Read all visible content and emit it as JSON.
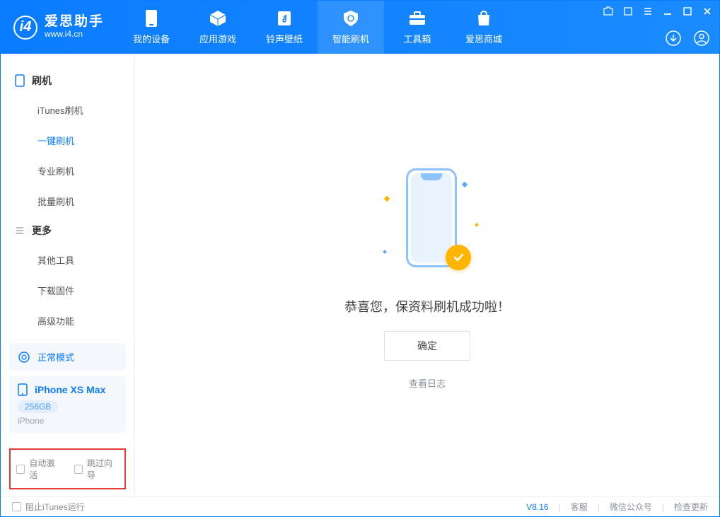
{
  "app": {
    "title_cn": "爱思助手",
    "title_en": "www.i4.cn"
  },
  "nav": [
    {
      "label": "我的设备"
    },
    {
      "label": "应用游戏"
    },
    {
      "label": "铃声壁纸"
    },
    {
      "label": "智能刷机"
    },
    {
      "label": "工具箱"
    },
    {
      "label": "爱思商城"
    }
  ],
  "sidebar": {
    "section1": "刷机",
    "items1": [
      "iTunes刷机",
      "一键刷机",
      "专业刷机",
      "批量刷机"
    ],
    "section2": "更多",
    "items2": [
      "其他工具",
      "下载固件",
      "高级功能"
    ]
  },
  "device_mode": "正常模式",
  "device": {
    "name": "iPhone XS Max",
    "storage": "256GB",
    "type": "iPhone"
  },
  "checkboxes": {
    "auto_activate": "自动激活",
    "skip_guide": "跳过向导"
  },
  "main": {
    "message": "恭喜您，保资料刷机成功啦！",
    "ok": "确定",
    "view_log": "查看日志"
  },
  "footer": {
    "block_itunes": "阻止iTunes运行",
    "version": "V8.16",
    "support": "客服",
    "wechat": "微信公众号",
    "update": "检查更新"
  }
}
